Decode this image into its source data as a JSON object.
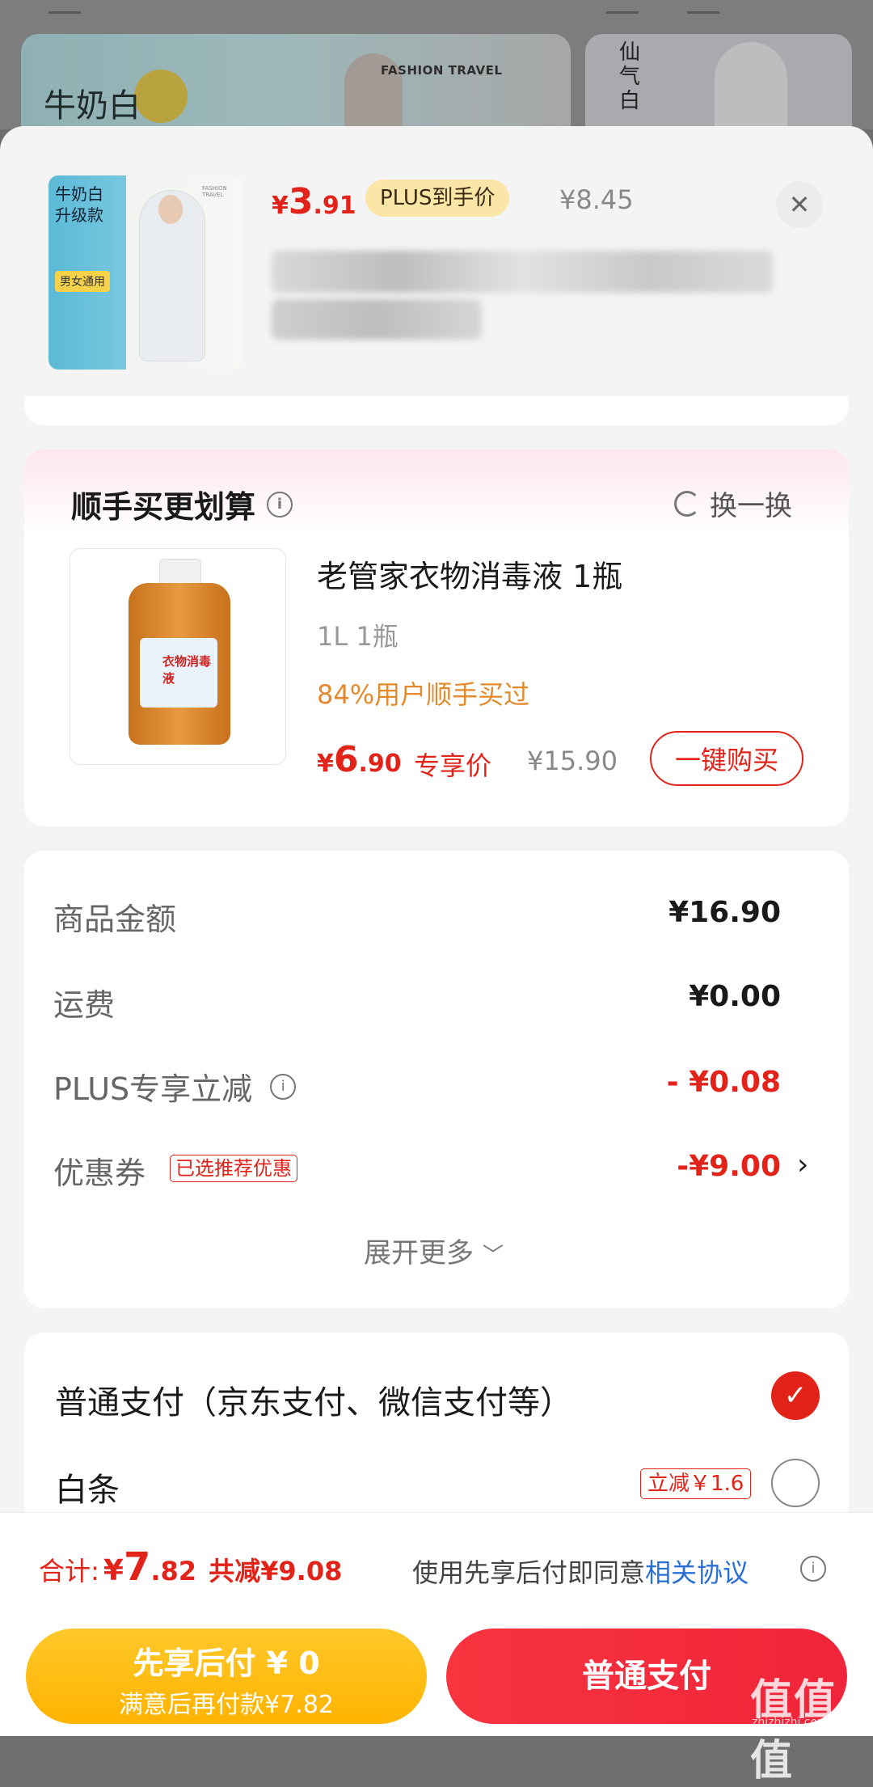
{
  "background": {
    "banner_left_title": "牛奶白",
    "banner_left_brand": "FASHION TRAVEL",
    "banner_right_title": "仙气白"
  },
  "product": {
    "thumb_line1": "牛奶白",
    "thumb_line2": "升级款",
    "thumb_tag": "男女通用",
    "thumb_brand": "FASHION TRAVEL",
    "price_symbol": "¥",
    "price_int": "3",
    "price_dec": ".91",
    "plus_badge": "PLUS到手价",
    "price_original": "¥8.45",
    "close_icon": "close-icon"
  },
  "addon": {
    "title": "顺手买更划算",
    "refresh_label": "换一换",
    "name": "老管家衣物消毒液 1瓶",
    "spec": "1L 1瓶",
    "stat": "84%用户顺手买过",
    "price_symbol": "¥",
    "price_int": "6",
    "price_dec": ".90",
    "exclusive": "专享价",
    "price_original": "¥15.90",
    "buy_label": "一键购买",
    "label_text": "衣物消毒液"
  },
  "summary": {
    "rows": [
      {
        "label": "商品金额",
        "value": "¥16.90"
      },
      {
        "label": "运费",
        "value": "¥0.00"
      },
      {
        "label": "PLUS专享立减",
        "value": "- ¥0.08"
      },
      {
        "label": "优惠券",
        "value": "-¥9.00",
        "tag": "已选推荐优惠"
      }
    ],
    "expand_label": "展开更多",
    "expand_icon": "chevron-down-icon"
  },
  "payment": {
    "normal_label": "普通支付（京东支付、微信支付等）",
    "baitiao_label": "白条",
    "baitiao_tag": "立减￥1.6"
  },
  "footer": {
    "total_label": "合计:",
    "total_symbol": "¥",
    "total_int": "7",
    "total_dec": ".82",
    "total_save": "共减¥9.08",
    "agree_text": "使用先享后付即同意",
    "agree_link": "相关协议",
    "later_line1": "先享后付 ¥ 0",
    "later_line2": "满意后再付款¥7.82",
    "normal_btn": "普通支付",
    "watermark": "值值值",
    "watermark_sub": "zhizhizhi.com"
  },
  "colors": {
    "accent_red": "#e2231a",
    "orange_stat": "#e38a2c",
    "link_blue": "#2a6fd6",
    "later_btn": "#ffb300",
    "normal_btn": "#f0243a"
  }
}
